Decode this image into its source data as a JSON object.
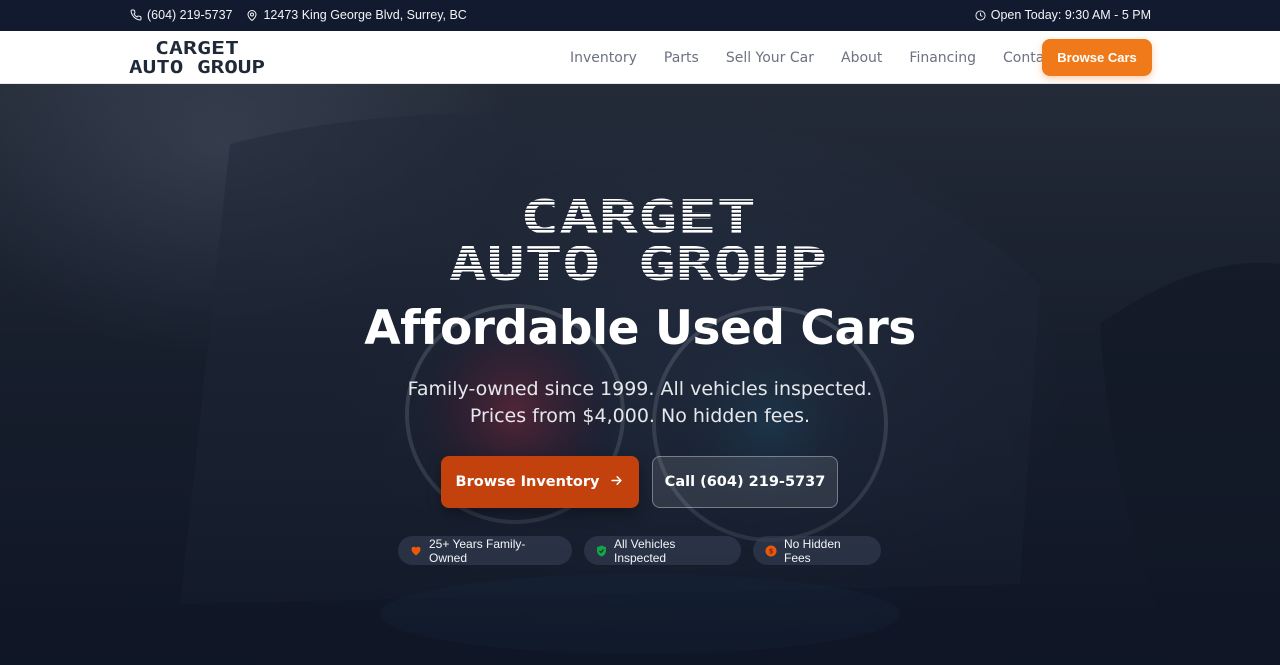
{
  "topbar": {
    "phone": "(604) 219-5737",
    "address": "12473 King George Blvd, Surrey, BC",
    "hours": "Open Today: 9:30 AM - 5 PM",
    "icons": [
      "phone-icon",
      "map-pin-icon",
      "clock-icon"
    ]
  },
  "nav": {
    "logo_line1": "CARGET",
    "logo_line2": "AUTO GROUP",
    "links": [
      "Inventory",
      "Parts",
      "Sell Your Car",
      "About",
      "Financing",
      "Contact"
    ],
    "cta": "Browse Cars"
  },
  "hero": {
    "logo_line1": "CARGET",
    "logo_line2": "AUTO GROUP",
    "headline": "Affordable Used Cars",
    "sub1": "Family-owned since 1999. All vehicles inspected.",
    "sub2": "Prices from $4,000. No hidden fees.",
    "primary_button": "Browse Inventory",
    "secondary_button": "Call (604) 219-5737",
    "badges": [
      {
        "label": "25+ Years Family-Owned",
        "icon": "heart-icon",
        "color": "#ea580c"
      },
      {
        "label": "All Vehicles Inspected",
        "icon": "shield-check-icon",
        "color": "#16a34a"
      },
      {
        "label": "No Hidden Fees",
        "icon": "dollar-icon",
        "color": "#ea580c"
      }
    ]
  },
  "colors": {
    "accent": "#f07a1a",
    "primary_button": "#c2410c",
    "topbar": "#111a2e",
    "hero_text": "#ffffff"
  }
}
